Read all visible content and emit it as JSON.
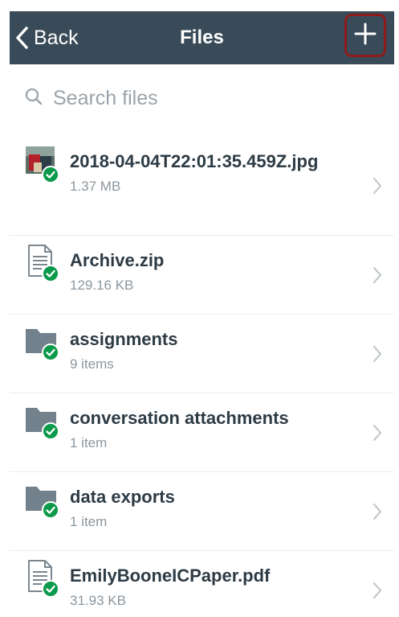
{
  "nav": {
    "back_label": "Back",
    "title": "Files",
    "add_icon": "plus-icon"
  },
  "search": {
    "placeholder": "Search files",
    "value": ""
  },
  "colors": {
    "navbar": "#394b58",
    "highlight": "#8e1b1b",
    "sync_check": "#0b9a4b",
    "folder": "#73818c"
  },
  "files": [
    {
      "name": "2018-04-04T22:01:35.459Z.jpg",
      "detail": "1.37 MB",
      "kind": "image",
      "icon": "image-thumbnail-icon"
    },
    {
      "name": "Archive.zip",
      "detail": "129.16 KB",
      "kind": "document",
      "icon": "document-icon"
    },
    {
      "name": "assignments",
      "detail": "9 items",
      "kind": "folder",
      "icon": "folder-icon"
    },
    {
      "name": "conversation attachments",
      "detail": "1 item",
      "kind": "folder",
      "icon": "folder-icon"
    },
    {
      "name": "data exports",
      "detail": "1 item",
      "kind": "folder",
      "icon": "folder-icon"
    },
    {
      "name": "EmilyBooneICPaper.pdf",
      "detail": "31.93 KB",
      "kind": "document",
      "icon": "document-icon"
    }
  ]
}
